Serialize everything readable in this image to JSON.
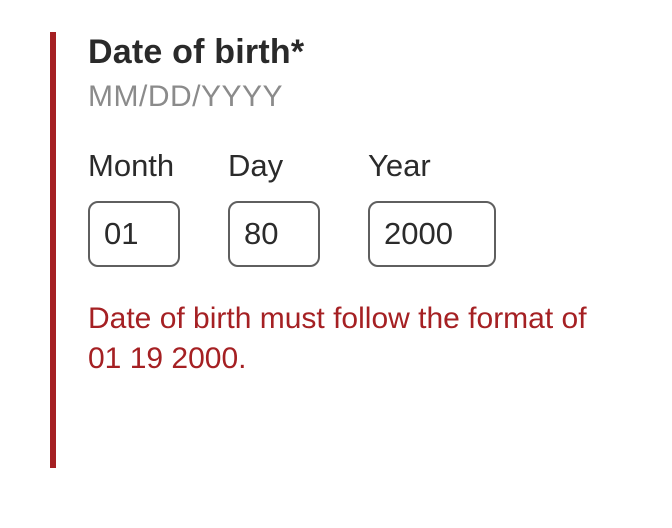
{
  "accent_color": "#a52023",
  "group": {
    "legend": "Date of birth*",
    "hint": "MM/DD/YYYY",
    "error": "Date of birth must follow the format of 01 19 2000."
  },
  "fields": {
    "month": {
      "label": "Month",
      "value": "01"
    },
    "day": {
      "label": "Day",
      "value": "80"
    },
    "year": {
      "label": "Year",
      "value": "2000"
    }
  }
}
